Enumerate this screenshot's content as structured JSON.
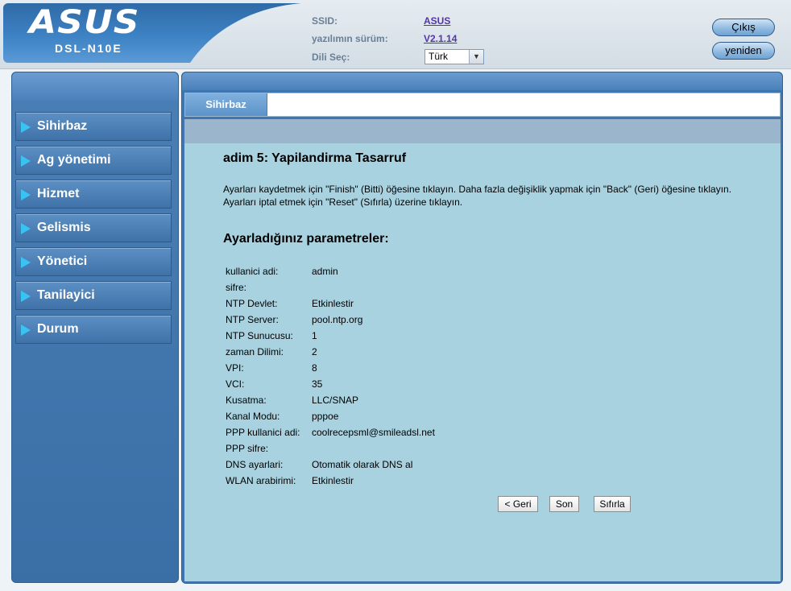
{
  "header": {
    "logo": "ASUS",
    "model": "DSL-N10E",
    "ssid_label": "SSID:",
    "ssid_value": "ASUS",
    "firmware_label": "yazılımın sürüm:",
    "firmware_value": "V2.1.14",
    "language_label": "Dili Seç:",
    "language_value": "Türk",
    "logout_label": "Çıkış",
    "reboot_label": "yeniden"
  },
  "sidebar": {
    "items": [
      {
        "label": "Sihirbaz"
      },
      {
        "label": "Ag yönetimi"
      },
      {
        "label": "Hizmet"
      },
      {
        "label": "Gelismis"
      },
      {
        "label": "Yönetici"
      },
      {
        "label": "Tanilayici"
      },
      {
        "label": "Durum"
      }
    ]
  },
  "main": {
    "tab_label": "Sihirbaz",
    "title": "adim 5: Yapilandirma Tasarruf",
    "description": "Ayarları kaydetmek için \"Finish\" (Bitti) öğesine tıklayın. Daha fazla değişiklik yapmak için \"Back\" (Geri) öğesine tıklayın. Ayarları iptal etmek için \"Reset\" (Sıfırla) üzerine tıklayın.",
    "params_title": "Ayarladığınız parametreler:",
    "params": [
      {
        "key": "kullanici adi:",
        "value": "admin"
      },
      {
        "key": "sifre:",
        "value": ""
      },
      {
        "key": "NTP Devlet:",
        "value": "Etkinlestir"
      },
      {
        "key": "NTP Server:",
        "value": "pool.ntp.org"
      },
      {
        "key": "NTP Sunucusu:",
        "value": "1"
      },
      {
        "key": "zaman Dilimi:",
        "value": "2"
      },
      {
        "key": "VPI:",
        "value": "8"
      },
      {
        "key": "VCI:",
        "value": "35"
      },
      {
        "key": "Kusatma:",
        "value": "LLC/SNAP"
      },
      {
        "key": "Kanal Modu:",
        "value": "pppoe"
      },
      {
        "key": "PPP kullanici adi:",
        "value": "coolrecepsml@smileadsl.net"
      },
      {
        "key": "PPP sifre:",
        "value": ""
      },
      {
        "key": "DNS ayarlari:",
        "value": "Otomatik olarak DNS al"
      },
      {
        "key": "WLAN arabirimi:",
        "value": "Etkinlestir"
      }
    ],
    "buttons": {
      "back": "< Geri",
      "finish": "Son",
      "reset": "Sıfırla"
    }
  },
  "colors": {
    "accent": "#3f76b0",
    "content_bg": "#a9d2e0",
    "menu_arrow": "#39c3f2"
  }
}
